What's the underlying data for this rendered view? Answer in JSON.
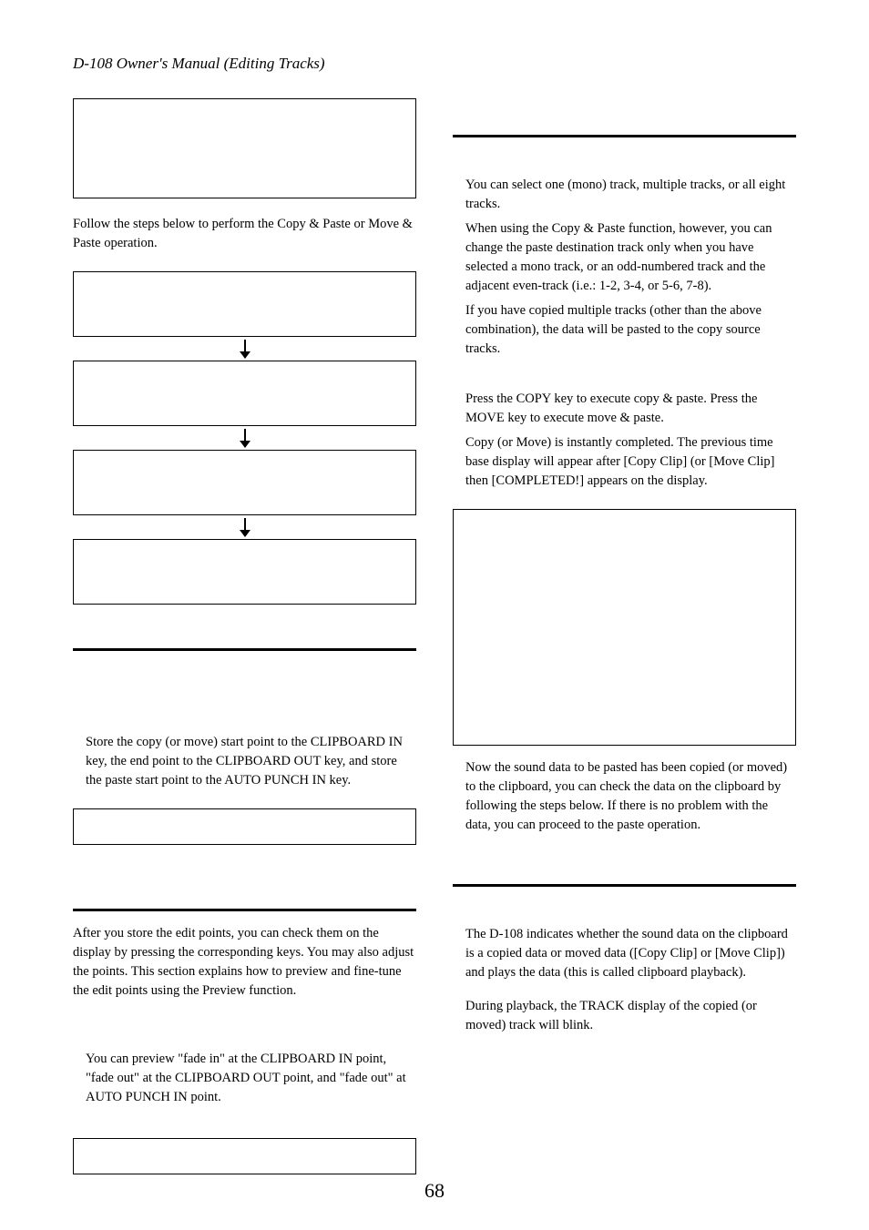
{
  "header": "D-108 Owner's Manual (Editing Tracks)",
  "page_number": "68",
  "left": {
    "followSteps": "Follow the steps below to perform the Copy & Paste or Move & Paste operation.",
    "storePoints": "Store the copy (or move) start point to the CLIPBOARD IN key, the end point to the CLIPBOARD OUT key, and store the paste start point to the AUTO PUNCH IN key.",
    "afterStore": "After you store the edit points, you can check them on the display by pressing the corresponding keys. You may also adjust the points. This section explains how to preview and fine-tune the edit points using the Preview function.",
    "previewFade": "You can preview \"fade in\" at the CLIPBOARD IN point, \"fade out\" at the CLIPBOARD OUT point, and \"fade out\" at AUTO PUNCH IN point."
  },
  "right": {
    "selectTracks": "You can select one (mono) track, multiple tracks, or all eight tracks.",
    "whenUsing": "When using the Copy & Paste function, however, you can change the paste destination track only when you have selected a mono track, or an odd-numbered track and the adjacent even-track (i.e.: 1-2, 3-4, or 5-6, 7-8).",
    "ifCopied": "If you have copied multiple tracks (other than the above combination), the data will be pasted to the copy source tracks.",
    "pressCopy": "Press the COPY key to execute copy & paste.  Press the MOVE key to execute move & paste.",
    "copyInstant": "Copy (or Move) is instantly completed.  The previous time base display will appear after [Copy Clip] (or [Move Clip] then [COMPLETED!] appears on the display.",
    "nowSound": "Now the sound data to be pasted has been copied (or moved) to the clipboard, you can check the data on the clipboard by following the steps below.  If there is no problem with the data, you can proceed to the paste operation.",
    "d108indicates": "The D-108 indicates whether the sound data on the clipboard is a copied data or moved data ([Copy Clip] or [Move Clip]) and plays the data (this is called clipboard playback).",
    "duringPlayback": "During playback, the TRACK display of the copied (or moved) track will blink."
  }
}
